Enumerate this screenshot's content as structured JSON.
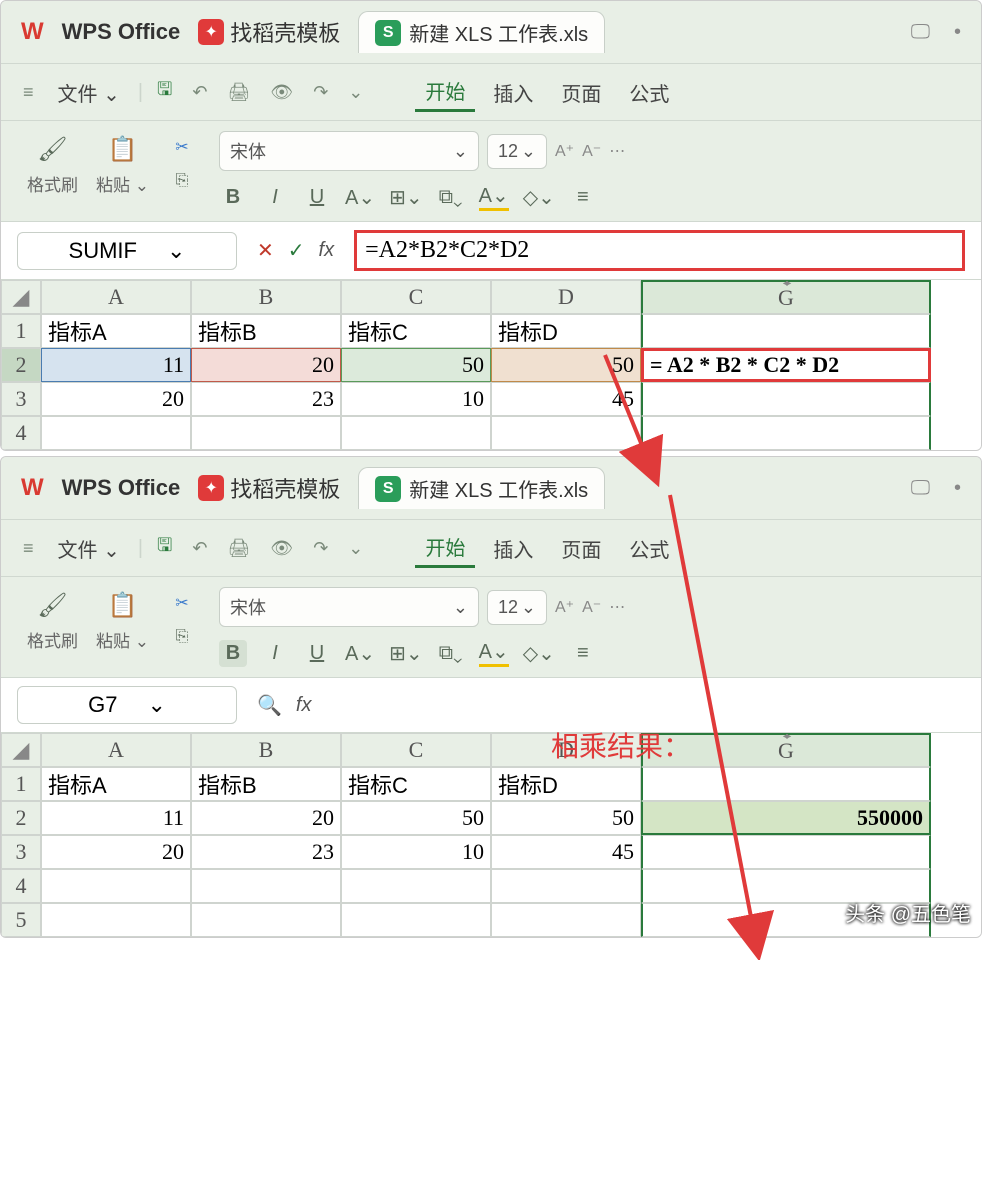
{
  "app": {
    "name": "WPS Office",
    "template_tab": "找稻壳模板",
    "active_tab": "新建 XLS 工作表.xls"
  },
  "menu": {
    "file": "文件",
    "start": "开始",
    "insert": "插入",
    "page": "页面",
    "formula": "公式"
  },
  "toolbar": {
    "format_painter": "格式刷",
    "paste": "粘贴",
    "font_name": "宋体",
    "font_size_1": "12"
  },
  "formula_bar_1": {
    "name_box": "SUMIF",
    "fx": "fx",
    "formula": "=A2*B2*C2*D2"
  },
  "formula_bar_2": {
    "name_box": "G7",
    "fx": "fx"
  },
  "headers": {
    "A": "A",
    "B": "B",
    "C": "C",
    "D": "D",
    "G": "G"
  },
  "rows": {
    "r1": "1",
    "r2": "2",
    "r3": "3",
    "r4": "4",
    "r5": "5"
  },
  "sheet1": {
    "h": {
      "a": "指标A",
      "b": "指标B",
      "c": "指标C",
      "d": "指标D"
    },
    "r2": {
      "a": "11",
      "b": "20",
      "c": "50",
      "d": "50",
      "g": "= A2 * B2 * C2 * D2"
    },
    "r3": {
      "a": "20",
      "b": "23",
      "c": "10",
      "d": "45"
    }
  },
  "sheet2": {
    "h": {
      "a": "指标A",
      "b": "指标B",
      "c": "指标C",
      "d": "指标D"
    },
    "r2": {
      "a": "11",
      "b": "20",
      "c": "50",
      "d": "50",
      "g": "550000"
    },
    "r3": {
      "a": "20",
      "b": "23",
      "c": "10",
      "d": "45"
    }
  },
  "annotation": "相乘结果：",
  "watermark": "头条 @五色笔",
  "glyph": {
    "save": "🖫",
    "chevron": "⌄",
    "cancel": "✕",
    "confirm": "✓",
    "search": "🔍",
    "cut": "✂",
    "copy": "⎘",
    "brush": "🖌",
    "clipboard": "📋",
    "undo": "↶",
    "redo": "↷",
    "print": "🖨",
    "preview": "👁",
    "italic": "I",
    "bold": "B",
    "underline": "U",
    "font_inc": "A⁺",
    "font_dec": "A⁻",
    "eraser": "◇",
    "border": "⊞",
    "merge": "⧉",
    "font_a": "A",
    "hamburger": "≡",
    "triangle": "◢",
    "monitor": "🖵",
    "dot": "•",
    "arrows_lr": "◂ ▸"
  }
}
